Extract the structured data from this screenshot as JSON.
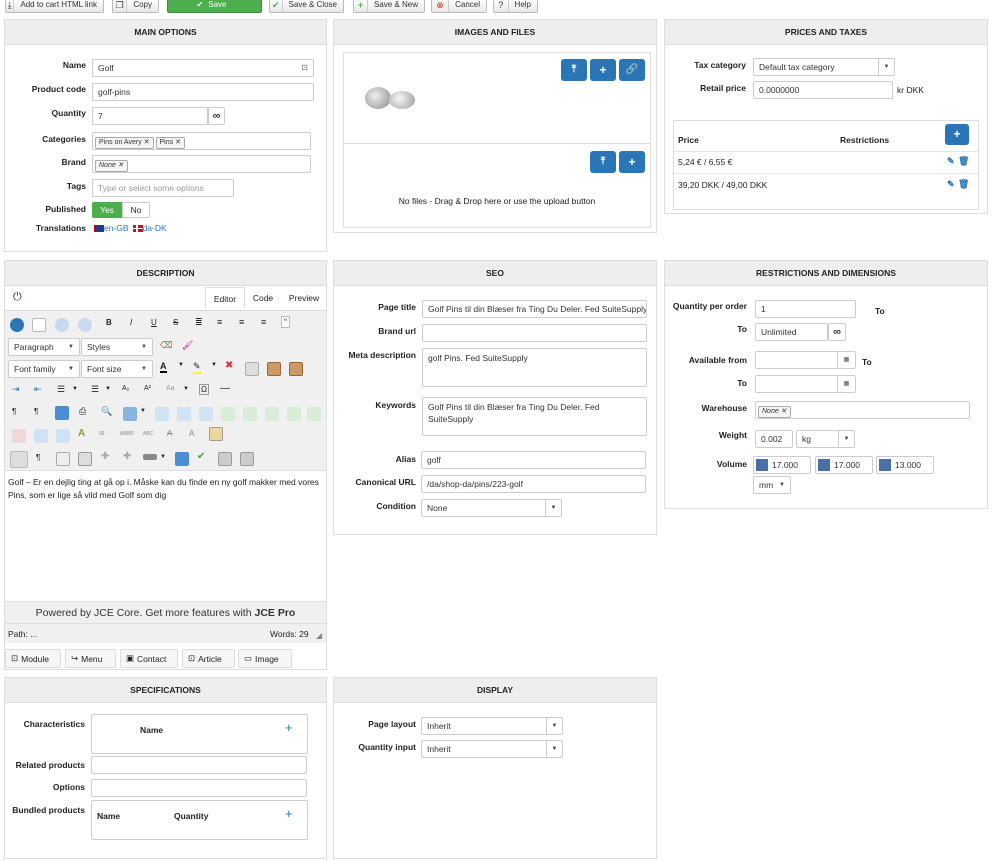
{
  "toolbar": {
    "add_to_cart": "Add to cart HTML link",
    "copy": "Copy",
    "save": "Save",
    "save_close": "Save & Close",
    "save_new": "Save & New",
    "cancel": "Cancel",
    "help": "Help"
  },
  "main_options": {
    "title": "MAIN OPTIONS",
    "name_label": "Name",
    "name_value": "Golf",
    "code_label": "Product code",
    "code_value": "golf-pins",
    "qty_label": "Quantity",
    "qty_value": "7",
    "cat_label": "Categories",
    "categories": [
      "Pins on Avery",
      "Pins"
    ],
    "brand_label": "Brand",
    "brand_tag": "None",
    "tags_label": "Tags",
    "tags_placeholder": "Type or select some options",
    "published_label": "Published",
    "yes": "Yes",
    "no": "No",
    "translations_label": "Translations",
    "lang1": "en-GB",
    "lang2": "da-DK"
  },
  "images": {
    "title": "IMAGES AND FILES",
    "no_files": "No files - Drag & Drop here or use the upload button"
  },
  "prices": {
    "title": "PRICES AND TAXES",
    "tax_label": "Tax category",
    "tax_value": "Default tax category",
    "retail_label": "Retail price",
    "retail_value": "0.0000000",
    "retail_unit": "kr DKK",
    "col_price": "Price",
    "col_restrictions": "Restrictions",
    "rows": [
      "5,24 € / 6,55 €",
      "39,20 DKK / 49,00 DKK"
    ]
  },
  "description": {
    "title": "DESCRIPTION",
    "tab_editor": "Editor",
    "tab_code": "Code",
    "tab_preview": "Preview",
    "paragraph": "Paragraph",
    "styles": "Styles",
    "font_family": "Font family",
    "font_size": "Font size",
    "body": "Golf – Er en dejlig ting at gå op i. Måske kan du finde en ny golf makker med vores Pins, som er lige så vild med Golf som dig",
    "powered_prefix": "Powered by JCE Core. Get more features with ",
    "powered_link": "JCE Pro",
    "path": "Path: ...",
    "words": "Words: 29",
    "btn_module": "Module",
    "btn_menu": "Menu",
    "btn_contact": "Contact",
    "btn_article": "Article",
    "btn_image": "Image"
  },
  "seo": {
    "title": "SEO",
    "page_title_label": "Page title",
    "page_title_value": "Golf Pins til din Blæser fra Ting Du Deler. Fed SuiteSupply",
    "brand_url_label": "Brand url",
    "meta_label": "Meta description",
    "meta_value": "golf Pins. Fed SuiteSupply",
    "keywords_label": "Keywords",
    "keywords_value": "Golf Pins til din Blæser fra Ting Du Deler. Fed SuiteSupply",
    "alias_label": "Alias",
    "alias_value": "golf",
    "canonical_label": "Canonical URL",
    "canonical_value": "/da/shop-da/pins/223-golf",
    "condition_label": "Condition",
    "condition_value": "None"
  },
  "restrictions": {
    "title": "RESTRICTIONS AND DIMENSIONS",
    "qpo_label": "Quantity per order",
    "qpo_value": "1",
    "to": "To",
    "to_label": "To",
    "to_value": "Unlimited",
    "avail_label": "Available from",
    "avail_to": "To",
    "warehouse_label": "Warehouse",
    "warehouse_tag": "None",
    "weight_label": "Weight",
    "weight_value": "0.002",
    "weight_unit": "kg",
    "volume_label": "Volume",
    "v1": "17.000",
    "v2": "17.000",
    "v3": "13.000",
    "vol_unit": "mm"
  },
  "specifications": {
    "title": "SPECIFICATIONS",
    "characteristics_label": "Characteristics",
    "name_col": "Name",
    "related_label": "Related products",
    "options_label": "Options",
    "bundled_label": "Bundled products",
    "bundled_name": "Name",
    "bundled_qty": "Quantity"
  },
  "display": {
    "title": "DISPLAY",
    "layout_label": "Page layout",
    "layout_value": "Inherit",
    "qty_input_label": "Quantity input",
    "qty_input_value": "Inherit"
  },
  "colors": {
    "green": "#4cae4c",
    "blue": "#2a75b5",
    "panel_header": "#eeeeee"
  }
}
